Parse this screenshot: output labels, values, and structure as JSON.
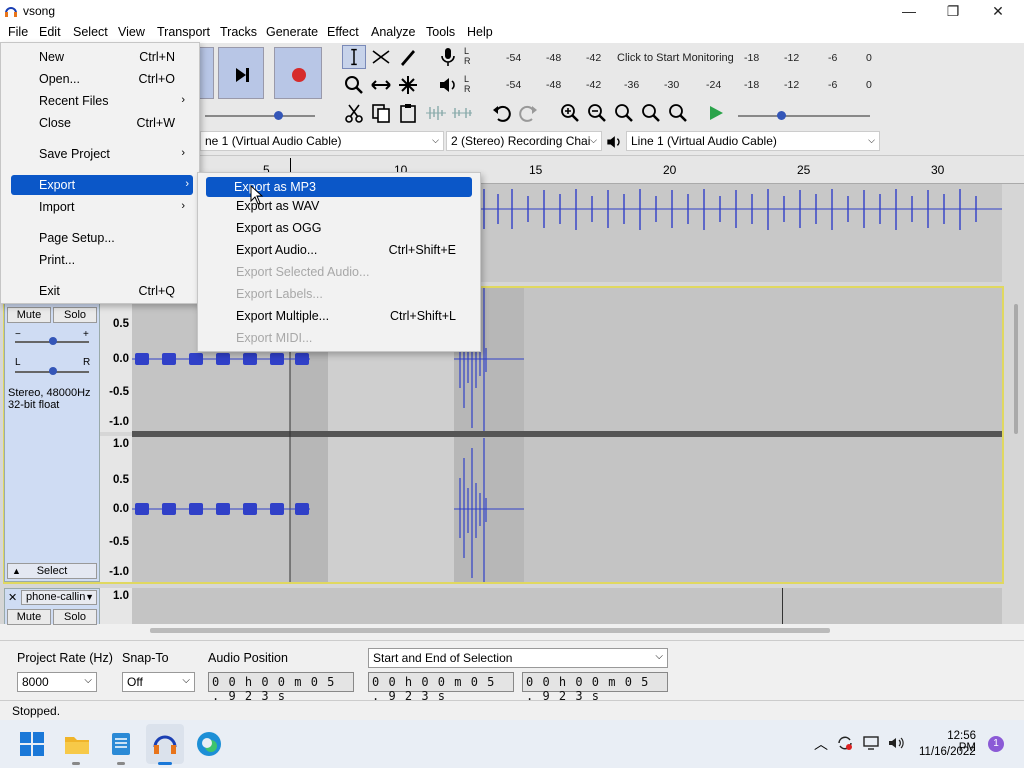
{
  "window": {
    "title": "vsong"
  },
  "menubar": [
    "File",
    "Edit",
    "Select",
    "View",
    "Transport",
    "Tracks",
    "Generate",
    "Effect",
    "Analyze",
    "Tools",
    "Help"
  ],
  "file_menu": {
    "items": [
      {
        "label": "New",
        "shortcut": "Ctrl+N"
      },
      {
        "label": "Open...",
        "shortcut": "Ctrl+O"
      },
      {
        "label": "Recent Files",
        "arrow": "›"
      },
      {
        "label": "Close",
        "shortcut": "Ctrl+W"
      },
      {
        "label": "Save Project",
        "arrow": "›"
      },
      {
        "label": "Export",
        "arrow": "›"
      },
      {
        "label": "Import",
        "arrow": "›"
      },
      {
        "label": "Page Setup..."
      },
      {
        "label": "Print..."
      },
      {
        "label": "Exit",
        "shortcut": "Ctrl+Q"
      }
    ]
  },
  "export_submenu": {
    "items": [
      {
        "label": "Export as MP3"
      },
      {
        "label": "Export as WAV"
      },
      {
        "label": "Export as OGG"
      },
      {
        "label": "Export Audio...",
        "shortcut": "Ctrl+Shift+E"
      },
      {
        "label": "Export Selected Audio..."
      },
      {
        "label": "Export Labels..."
      },
      {
        "label": "Export Multiple...",
        "shortcut": "Ctrl+Shift+L"
      },
      {
        "label": "Export MIDI..."
      }
    ]
  },
  "meters": {
    "record_ticks": [
      "-54",
      "-48",
      "-42",
      "-18",
      "-12",
      "-6",
      "0"
    ],
    "record_prompt": "Click to Start Monitoring",
    "play_ticks": [
      "-54",
      "-48",
      "-42",
      "-36",
      "-30",
      "-24",
      "-18",
      "-12",
      "-6",
      "0"
    ],
    "left": "L",
    "right": "R"
  },
  "devices": {
    "host": "ne 1 (Virtual Audio Cable)",
    "channels": "2 (Stereo) Recording Chai",
    "output": "Line 1 (Virtual Audio Cable)"
  },
  "ruler": [
    "5",
    "10",
    "15",
    "20",
    "25",
    "30"
  ],
  "track2": {
    "mute": "Mute",
    "solo": "Solo",
    "info1": "Stereo, 48000Hz",
    "info2": "32-bit float",
    "select": "Select",
    "scale_top": [
      "0.5",
      "0.0",
      "-0.5",
      "-1.0"
    ],
    "scale_bottom": [
      "1.0",
      "0.5",
      "0.0",
      "-0.5",
      "-1.0"
    ]
  },
  "track3": {
    "name": "phone-callin",
    "mute": "Mute",
    "solo": "Solo",
    "scale_top": "1.0"
  },
  "selection_bar": {
    "rate_label": "Project Rate (Hz)",
    "rate_value": "8000",
    "snap_label": "Snap-To",
    "snap_value": "Off",
    "pos_label": "Audio Position",
    "pos_value": "0 0 h 0 0 m 0 5 . 9 2 3 s",
    "sel_mode": "Start and End of Selection",
    "start_value": "0 0 h 0 0 m 0 5 . 9 2 3 s",
    "end_value": "0 0 h 0 0 m 0 5 . 9 2 3 s"
  },
  "status": {
    "text": "Stopped."
  },
  "taskbar": {
    "time": "12:56 PM",
    "date": "11/16/2022",
    "badge": "1"
  },
  "colors": {
    "accent": "#0b57c8",
    "track_bg": "#cfdcf3",
    "wave": "#3040c8"
  }
}
